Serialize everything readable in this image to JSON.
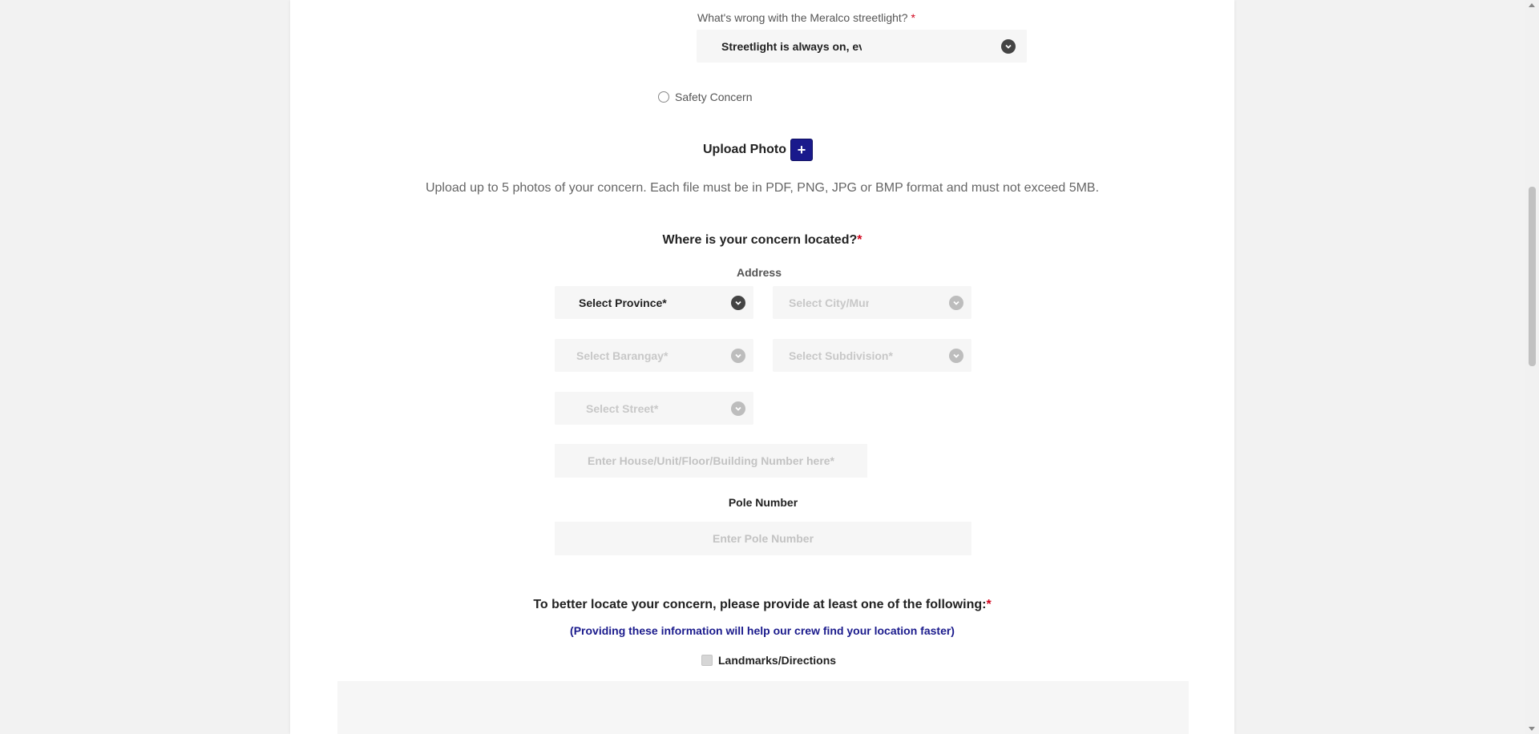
{
  "issue": {
    "question": "What's wrong with the Meralco streetlight?",
    "required_mark": "*",
    "selected_value": "Streetlight is always on, even during daytime"
  },
  "safety": {
    "label": "Safety Concern"
  },
  "upload": {
    "title": "Upload Photo",
    "button_glyph": "+",
    "help": "Upload up to 5 photos of your concern. Each file must be in PDF, PNG, JPG or BMP format and must not exceed 5MB."
  },
  "location": {
    "question": "Where is your concern located?",
    "required_mark": "*",
    "address_label": "Address",
    "province": "Select Province*",
    "city": "Select City/Municip",
    "barangay": "Select Barangay*",
    "subdivision": "Select Subdivision*",
    "street": "Select Street*",
    "house_placeholder": "Enter House/Unit/Floor/Building Number here*"
  },
  "pole": {
    "label": "Pole Number",
    "placeholder": "Enter Pole Number"
  },
  "locate": {
    "question": "To better locate your concern, please provide at least one of the following:",
    "required_mark": "*",
    "note": "(Providing these information will help our crew find your location faster)",
    "landmarks_label": "Landmarks/Directions"
  },
  "colors": {
    "accent_navy": "#1a1a8c",
    "note_blue": "#1a1a8c",
    "required_red": "#d0021b"
  }
}
